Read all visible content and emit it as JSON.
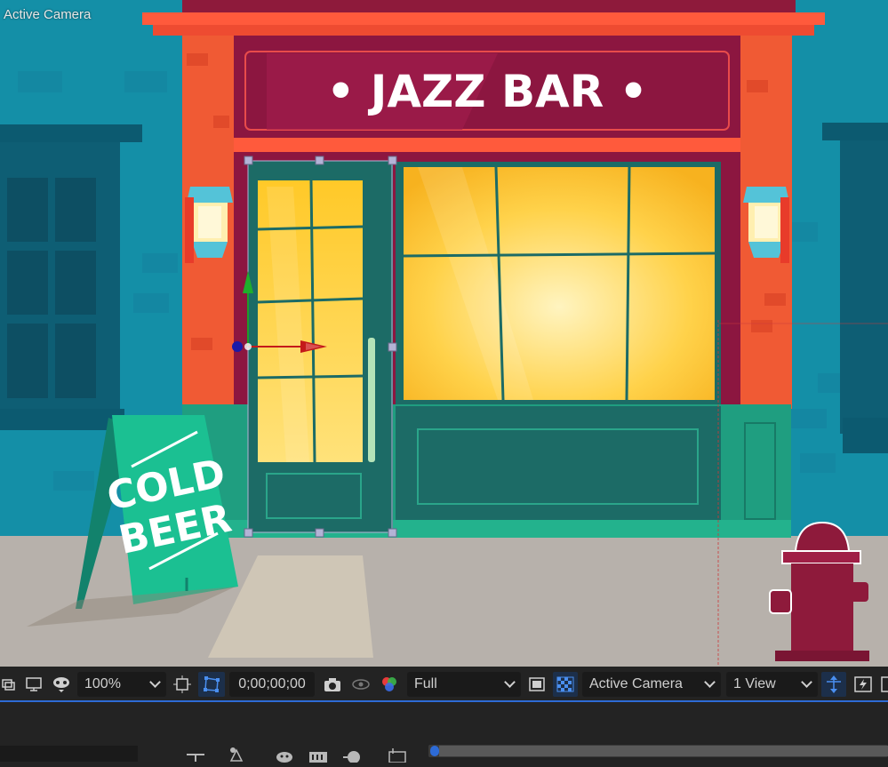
{
  "viewer": {
    "camera_label": "Active Camera",
    "sign_text": "JAZZ BAR",
    "sandwich_board_line1": "COLD",
    "sandwich_board_line2": "BEER"
  },
  "toolbar": {
    "zoom": "100%",
    "timecode": "0;00;00;00",
    "resolution": "Full",
    "camera": "Active Camera",
    "views": "1 View"
  },
  "colors": {
    "accent": "#2d6bd6",
    "wall": "#1aa0b8",
    "brick": "#f05a34",
    "sign": "#8c1640",
    "window_glow": "#ffd24a",
    "door": "#1c6b66",
    "ground": "#b9b3ad"
  }
}
